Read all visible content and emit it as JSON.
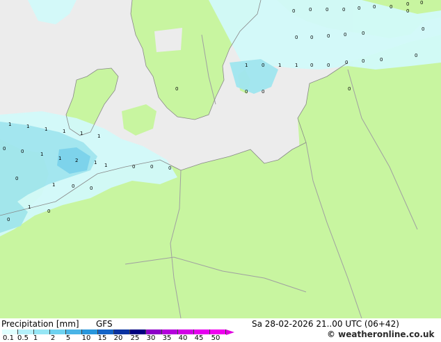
{
  "title": "Precipitation [mm]",
  "model": "GFS",
  "datetime": "Sa 28-02-2026 21..00 UTC (06+42)",
  "credit": "© weatheronline.co.uk",
  "legend": {
    "labels": [
      "0.1",
      "0.5",
      "1",
      "2",
      "5",
      "10",
      "15",
      "20",
      "25",
      "30",
      "35",
      "40",
      "45",
      "50"
    ],
    "colors": [
      "#e0ffff",
      "#b4f0fa",
      "#96e6f5",
      "#6ed2f0",
      "#4ab4e6",
      "#2896dc",
      "#1464c8",
      "#0a32a0",
      "#000080",
      "#8c00c8",
      "#b400dc",
      "#d200e6",
      "#e600f0",
      "#f000f0"
    ]
  },
  "colors": {
    "land": "#c8f5a0",
    "sea": "#ececec",
    "precip_light": "#d2fafa",
    "precip_mid": "#a0e6f0",
    "precip_heavy": "#78d2eb",
    "border": "#a0a0a0"
  },
  "value_labels": [
    "1",
    "1",
    "1",
    "1",
    "1",
    "0",
    "0",
    "1",
    "1",
    "2",
    "1",
    "1",
    "1",
    "0",
    "1",
    "0",
    "0",
    "0",
    "0",
    "1",
    "1",
    "0",
    "0",
    "0",
    "1",
    "1",
    "0",
    "0",
    "0",
    "0",
    "0",
    "0",
    "0",
    "0",
    "0",
    "0",
    "0",
    "0",
    "0",
    "0",
    "0",
    "0",
    "0",
    "0",
    "0",
    "0",
    "0",
    "0",
    "0",
    "0",
    "0",
    "0",
    "0"
  ]
}
